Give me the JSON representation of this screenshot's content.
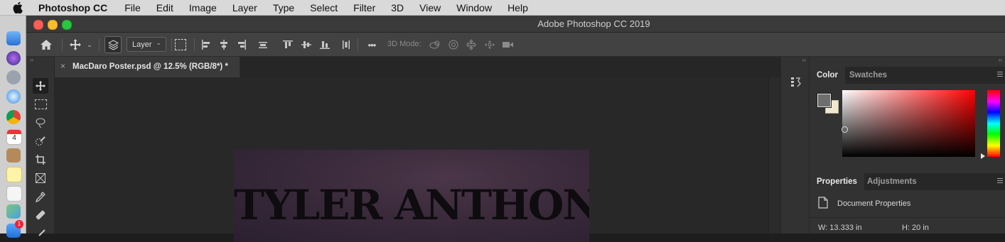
{
  "menubar": {
    "apple_icon": "apple-logo-icon",
    "items": [
      "Photoshop CC",
      "File",
      "Edit",
      "Image",
      "Layer",
      "Type",
      "Select",
      "Filter",
      "3D",
      "View",
      "Window",
      "Help"
    ]
  },
  "window": {
    "title": "Adobe Photoshop CC 2019"
  },
  "options_bar": {
    "home_icon": "home-icon",
    "move_tool_icon": "move-tool-icon",
    "auto_select_icon": "auto-select-layers-icon",
    "layer_select_value": "Layer",
    "transform_controls_icon": "transform-controls-icon",
    "more_label": "•••",
    "mode_3d_label": "3D Mode:"
  },
  "document": {
    "tab_close": "×",
    "tab_title": "MacDaro Poster.psd @ 12.5% (RGB/8*) *",
    "poster_text": "TYLER ANTHONY"
  },
  "color_panel": {
    "tabs": [
      "Color",
      "Swatches"
    ],
    "foreground_color": "#6e6e6e",
    "background_color": "#f0e9cf"
  },
  "properties_panel": {
    "tabs": [
      "Properties",
      "Adjustments"
    ],
    "doc_label": "Document Properties",
    "width": "W: 13.333 in",
    "height": "H: 20 in"
  },
  "colors": {
    "menubar_bg": "#d9d9d9",
    "app_bg": "#323232",
    "canvas_bg": "#282828"
  }
}
